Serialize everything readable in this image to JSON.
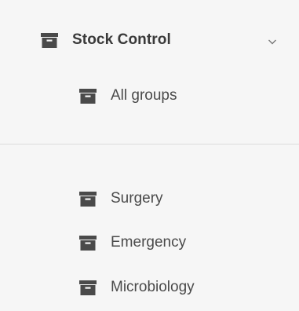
{
  "menu": {
    "header": {
      "label": "Stock Control",
      "icon": "archive-box-icon",
      "expand_icon": "chevron-down-icon"
    },
    "top_items": [
      {
        "label": "All groups",
        "icon": "archive-box-icon"
      }
    ],
    "group_items": [
      {
        "label": "Surgery",
        "icon": "archive-box-icon"
      },
      {
        "label": "Emergency",
        "icon": "archive-box-icon"
      },
      {
        "label": "Microbiology",
        "icon": "archive-box-icon"
      }
    ]
  },
  "colors": {
    "icon": "#4a4a4a",
    "header_text": "#3a3a3a",
    "item_text": "#4a4a4a",
    "background": "#f6f6f6",
    "divider": "#dcdcdc"
  }
}
